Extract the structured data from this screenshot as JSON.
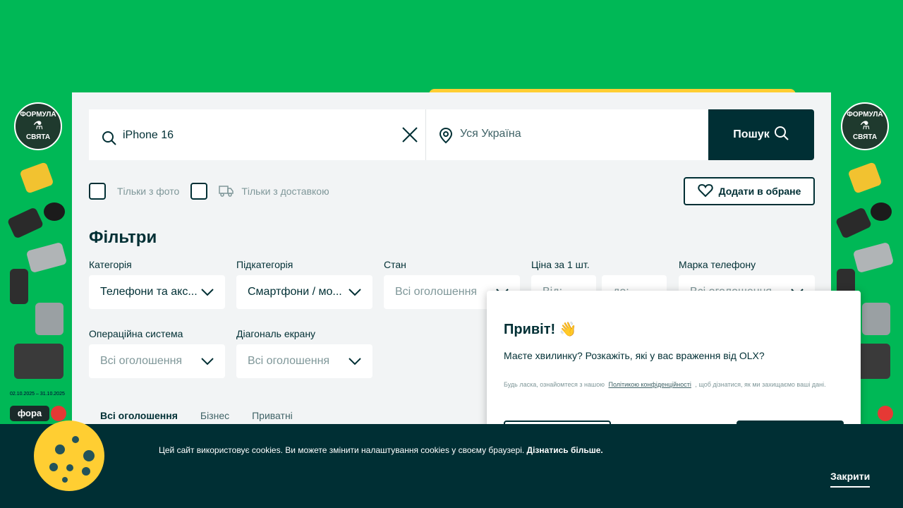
{
  "search": {
    "query": "iPhone 16",
    "location": "Уся Україна",
    "button_label": "Пошук"
  },
  "checkboxes": {
    "photo_only": "Тільки з фото",
    "delivery_only": "Тільки з доставкою"
  },
  "favorites_button": "Додати в обране",
  "filters": {
    "title": "Фільтри",
    "category": {
      "label": "Категорія",
      "value": "Телефони та акс..."
    },
    "subcategory": {
      "label": "Підкатегорія",
      "value": "Смартфони / мо..."
    },
    "condition": {
      "label": "Стан",
      "value": "Всі оголошення"
    },
    "price": {
      "label": "Ціна за 1 шт.",
      "from": "Від:",
      "to": "до:"
    },
    "brand": {
      "label": "Марка телефону",
      "value": "Всі оголошення"
    },
    "os": {
      "label": "Операційна система",
      "value": "Всі оголошення"
    },
    "diagonal": {
      "label": "Діагональ екрану",
      "value": "Всі оголошення"
    }
  },
  "tabs": [
    "Всі оголошення",
    "Бізнес",
    "Приватні"
  ],
  "popup": {
    "title": "Привіт! 👋",
    "question": "Маєте хвилинку? Розкажіть, які у вас враження від OLX?",
    "note_before": "Будь ласка, ознайомтеся з нашою",
    "note_link": "Політикою конфіденційності",
    "note_after": ", щоб дізнатися, як ми захищаємо ваші дані."
  },
  "cookie": {
    "text": "Цей сайт використовує cookies. Ви можете змінити налаштування cookies у своєму браузері.",
    "link": "Дізнатись більше.",
    "close": "Закрити"
  },
  "ad": {
    "badge_line1": "ФОРМУЛА",
    "badge_line2": "СВЯТА",
    "date": "02.10.2025 – 31.10.2025",
    "logo": "фора"
  },
  "colors": {
    "background": "#00b856",
    "dark": "#002f34",
    "accent": "#ffce32"
  }
}
